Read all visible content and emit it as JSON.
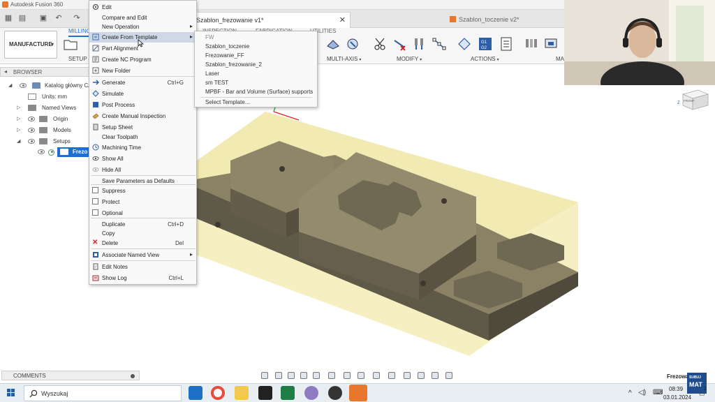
{
  "app": {
    "title": "Autodesk Fusion 360"
  },
  "tabs": [
    {
      "label": "Szablon_frezowanie v1*"
    },
    {
      "label": "Szablon_toczenie v2*"
    }
  ],
  "toolbar": {
    "workspace": "MANUFACTURE",
    "ribbon_tabs": [
      "MILLING",
      "INSPECTION",
      "FABRICATION",
      "UTILITIES"
    ],
    "groups": [
      "SETUP",
      "MULTI-AXIS",
      "MODIFY",
      "ACTIONS",
      "MA"
    ]
  },
  "browser": {
    "title": "BROWSER",
    "root": "Katalog główny CA",
    "units": "Units: mm",
    "items": [
      "Named Views",
      "Origin",
      "Models",
      "Setups"
    ],
    "selected": "Frezo"
  },
  "context_menu": {
    "items": [
      {
        "label": "Edit",
        "shortcut": ""
      },
      {
        "label": "Compare and Edit",
        "shortcut": ""
      },
      {
        "label": "New Operation",
        "shortcut": ""
      },
      {
        "label": "Create From Template",
        "shortcut": ""
      },
      {
        "label": "Part Alignment",
        "shortcut": ""
      },
      {
        "label": "Create NC Program",
        "shortcut": ""
      },
      {
        "label": "New Folder",
        "shortcut": ""
      },
      {
        "label": "Generate",
        "shortcut": "Ctrl+G"
      },
      {
        "label": "Simulate",
        "shortcut": ""
      },
      {
        "label": "Post Process",
        "shortcut": ""
      },
      {
        "label": "Create Manual Inspection",
        "shortcut": ""
      },
      {
        "label": "Setup Sheet",
        "shortcut": ""
      },
      {
        "label": "Clear Toolpath",
        "shortcut": ""
      },
      {
        "label": "Machining Time",
        "shortcut": ""
      },
      {
        "label": "Show All",
        "shortcut": ""
      },
      {
        "label": "Hide All",
        "shortcut": ""
      },
      {
        "label": "Save Parameters as Defaults",
        "shortcut": ""
      },
      {
        "label": "Suppress",
        "shortcut": ""
      },
      {
        "label": "Protect",
        "shortcut": ""
      },
      {
        "label": "Optional",
        "shortcut": ""
      },
      {
        "label": "Duplicate",
        "shortcut": "Ctrl+D"
      },
      {
        "label": "Copy",
        "shortcut": ""
      },
      {
        "label": "Delete",
        "shortcut": "Del"
      },
      {
        "label": "Associate Named View",
        "shortcut": ""
      },
      {
        "label": "Edit Notes",
        "shortcut": ""
      },
      {
        "label": "Show Log",
        "shortcut": "Ctrl+L"
      }
    ]
  },
  "submenu": {
    "items": [
      "FW",
      "Szablon_toczenie",
      "Frezowanie_FF",
      "Szablon_frezowanie_2",
      "Laser",
      "sm TEST",
      "MPBF - Bar and Volume (Surface) supports",
      "Select Template..."
    ]
  },
  "comments": {
    "label": "COMMENTS"
  },
  "document_short": "Frezowa",
  "viewcube": {
    "face": "FRONT",
    "axis": "Z"
  },
  "taskbar": {
    "search": "Wyszukaj",
    "time": "08:39",
    "date": "03.01.2024",
    "notifications": "2",
    "badge": [
      "SUBUJ",
      "MAT"
    ]
  },
  "colors": {
    "accent": "#1f6fd1",
    "part_top": "#8b8265",
    "part_side": "#5f5a48",
    "stock": "#efe6a8"
  }
}
